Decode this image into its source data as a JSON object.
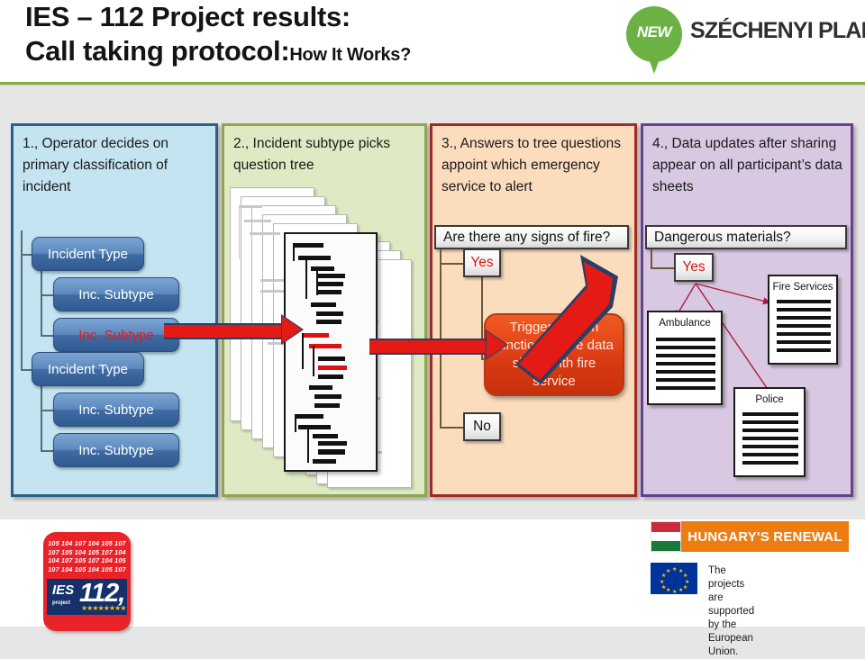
{
  "header": {
    "title_line1": "IES – 112 Project results:",
    "title_line2_main": "Call taking protocol:",
    "title_line2_sub": "How It Works?",
    "logo": {
      "pin_text": "NEW",
      "brand_text": "SZÉCHENYI PLAN"
    }
  },
  "panels": [
    {
      "id": "panel1",
      "title": "1., Operator decides on primary classification of incident",
      "fill_color": "#c3e4f0",
      "border_color": "#2e5f84",
      "nodes": [
        {
          "label": "Incident Type",
          "highlight": false
        },
        {
          "label": "Inc. Subtype",
          "highlight": false
        },
        {
          "label": "Inc. Subtype",
          "highlight": true
        },
        {
          "label": "Incident Type",
          "highlight": false
        },
        {
          "label": "Inc. Subtype",
          "highlight": false
        },
        {
          "label": "Inc. Subtype",
          "highlight": false
        }
      ]
    },
    {
      "id": "panel2",
      "title": "2., Incident subtype picks question tree",
      "fill_color": "#dfeac4",
      "border_color": "#8fa64e"
    },
    {
      "id": "panel3",
      "title": "3., Answers to tree questions appoint which emergency service to alert",
      "fill_color": "#fbddbe",
      "border_color": "#a32a22",
      "question": "Are there any signs of fire?",
      "answer_yes": "Yes",
      "answer_no": "No",
      "trigger": "Trigger system function: share data sheet with fire service",
      "trigger_color": "#e4451a"
    },
    {
      "id": "panel4",
      "title": "4., Data updates after sharing appear on all participant’s data sheets",
      "fill_color": "#d8c8e2",
      "border_color": "#6b3f8f",
      "question": "Dangerous materials?",
      "answer_yes": "Yes",
      "documents": [
        {
          "label": "Fire Services"
        },
        {
          "label": "Ambulance"
        },
        {
          "label": "Police"
        }
      ]
    }
  ],
  "footer": {
    "ies_logo": {
      "numbers_line1": "105 104 107 104 105 107",
      "numbers_line2": "107 105 104 105 107 104",
      "numbers_line3": "104 107 105 107 104 105",
      "numbers_line4": "107 104 105 104 105 107",
      "ies_text": "IES",
      "project_text": "project",
      "number_text": "112,",
      "stars": "★★★★★★★★"
    },
    "hungary": {
      "label": "HUNGARY'S RENEWAL",
      "bar_color": "#ee7d11"
    },
    "eu": {
      "line1": "The projects are supported",
      "line2": "by the European Union."
    }
  },
  "accent_colors": {
    "arrow_red": "#e41a14",
    "arrow_outline": "#2a3f66",
    "divider_green": "#8aab3e",
    "highlight_red": "#e01b1b"
  }
}
